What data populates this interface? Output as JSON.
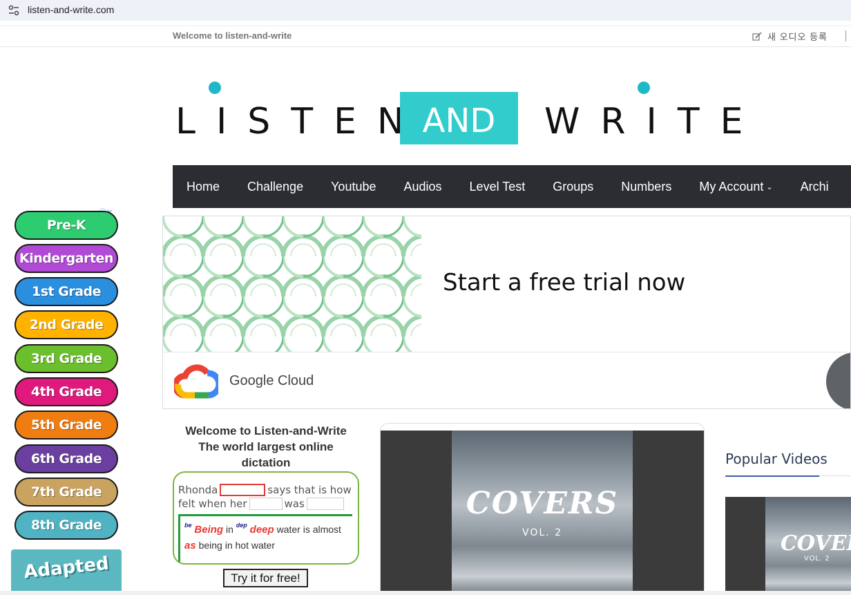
{
  "browser": {
    "url": "listen-and-write.com",
    "icon": "tune-icon"
  },
  "topbar": {
    "welcome": "Welcome to listen-and-write",
    "audio_register": "새 오디오 등록",
    "edit_icon": "edit-icon"
  },
  "logo": {
    "listen": "LISTEN",
    "and": "AND",
    "write": "WRITE",
    "accent_color": "#33cccc"
  },
  "nav": {
    "items": [
      {
        "label": "Home"
      },
      {
        "label": "Challenge"
      },
      {
        "label": "Youtube"
      },
      {
        "label": "Audios"
      },
      {
        "label": "Level Test"
      },
      {
        "label": "Groups"
      },
      {
        "label": "Numbers"
      },
      {
        "label": "My Account"
      },
      {
        "label": "Archi"
      }
    ],
    "background": "#2b2d33"
  },
  "left_ad": {
    "grades": [
      {
        "label": "Pre-K",
        "color": "#2ecc71"
      },
      {
        "label": "Kindergarten",
        "color": "#b14ad6"
      },
      {
        "label": "1st Grade",
        "color": "#2b8fe0"
      },
      {
        "label": "2nd Grade",
        "color": "#ffb300"
      },
      {
        "label": "3rd Grade",
        "color": "#6cbf2c"
      },
      {
        "label": "4th Grade",
        "color": "#e0197d"
      },
      {
        "label": "5th Grade",
        "color": "#ef7d12"
      },
      {
        "label": "6th Grade",
        "color": "#6a3fa0"
      },
      {
        "label": "7th Grade",
        "color": "#c9a35f"
      },
      {
        "label": "8th Grade",
        "color": "#4fb3c4"
      }
    ],
    "adapted": "Adapted"
  },
  "google_ad": {
    "headline": "Start a free trial now",
    "brand": "Google Cloud"
  },
  "dictation": {
    "title_lines": [
      "Welcome to Listen-and-Write",
      "The world largest online",
      "dictation"
    ],
    "line1_a": "Rhonda",
    "line1_b": "says that is how",
    "line2_a": "felt when her",
    "line2_b": "was",
    "sup1": "be",
    "err1": "Being",
    "word_in": "in",
    "sup2": "dep",
    "err2": "deep",
    "rest1": "water is almost",
    "err3": "as",
    "rest2": "being in hot water",
    "button": "Try it for free!"
  },
  "video": {
    "cover_title": "COVERS",
    "cover_vol": "VOL. 2"
  },
  "popular": {
    "heading": "Popular Videos",
    "thumb_title": "COVERS",
    "thumb_vol": "VOL. 2"
  }
}
